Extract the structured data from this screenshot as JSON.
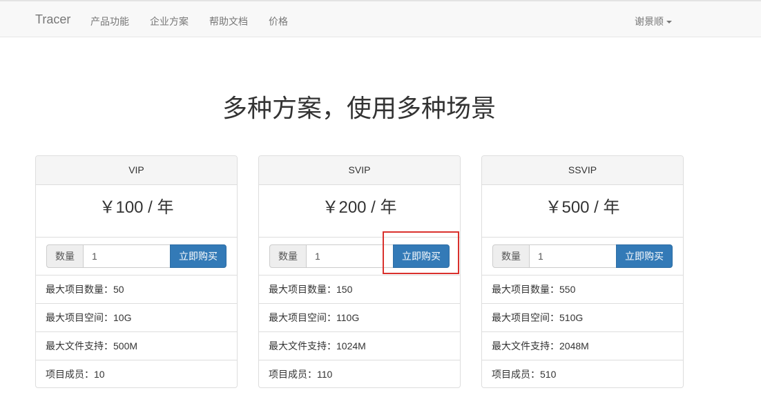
{
  "navbar": {
    "brand": "Tracer",
    "links": [
      "产品功能",
      "企业方案",
      "帮助文档",
      "价格"
    ],
    "user": "谢景顺"
  },
  "headline": "多种方案，使用多种场景",
  "plans": [
    {
      "name": "VIP",
      "price": "￥100 / 年",
      "qty_label": "数量",
      "qty_value": "1",
      "buy_label": "立即购买",
      "features": [
        "最大项目数量：50",
        "最大项目空间：10G",
        "最大文件支持：500M",
        "项目成员：10"
      ]
    },
    {
      "name": "SVIP",
      "price": "￥200 / 年",
      "qty_label": "数量",
      "qty_value": "1",
      "buy_label": "立即购买",
      "features": [
        "最大项目数量：150",
        "最大项目空间：110G",
        "最大文件支持：1024M",
        "项目成员：110"
      ]
    },
    {
      "name": "SSVIP",
      "price": "￥500 / 年",
      "qty_label": "数量",
      "qty_value": "1",
      "buy_label": "立即购买",
      "features": [
        "最大项目数量：550",
        "最大项目空间：510G",
        "最大文件支持：2048M",
        "项目成员：510"
      ]
    }
  ],
  "colors": {
    "primary": "#337ab7",
    "highlight": "#d9302c",
    "navbar_bg": "#f8f8f8"
  }
}
